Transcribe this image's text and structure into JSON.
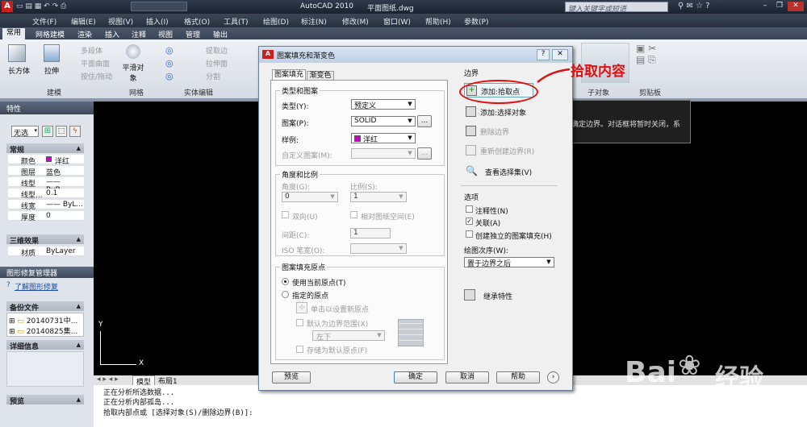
{
  "title_bar": {
    "app": "AutoCAD 2010",
    "file": "平面图纸.dwg",
    "search_placeholder": "键入关键字或短语"
  },
  "menu": [
    "文件(F)",
    "编辑(E)",
    "视图(V)",
    "插入(I)",
    "格式(O)",
    "工具(T)",
    "绘图(D)",
    "标注(N)",
    "修改(M)",
    "窗口(W)",
    "帮助(H)",
    "参数(P)"
  ],
  "ribbon_tabs": [
    "常用",
    "网格建模",
    "渲染",
    "插入",
    "注释",
    "视图",
    "管理",
    "输出"
  ],
  "ribbon": {
    "big_buttons": [
      "长方体",
      "拉伸",
      "平滑对象"
    ],
    "small_buttons": [
      "多段体",
      "平面曲面",
      "按住/拖动",
      "提取边",
      "拉伸面",
      "分割"
    ],
    "groups": [
      "建模",
      "网格",
      "实体编辑",
      "子对象",
      "剪贴板"
    ]
  },
  "properties_panel": {
    "title": "特性",
    "selection": "无选",
    "section_general": "常规",
    "rows": [
      {
        "k": "颜色",
        "v": "洋红"
      },
      {
        "k": "图层",
        "v": "蓝色"
      },
      {
        "k": "线型",
        "v": "—— ByB..."
      },
      {
        "k": "线型...",
        "v": "0.1"
      },
      {
        "k": "线宽",
        "v": "—— ByL..."
      },
      {
        "k": "厚度",
        "v": "0"
      }
    ],
    "section_3d": "三维效果",
    "row_material": {
      "k": "材质",
      "v": "ByLayer"
    }
  },
  "repair_panel": {
    "title": "图形修复管理器",
    "link": "了解图形修复",
    "backup_header": "备份文件",
    "files": [
      "20140731中...",
      "20140825集..."
    ],
    "details_header": "详细信息",
    "preview_header": "预览"
  },
  "model_tabs": [
    "模型",
    "布局1"
  ],
  "ucs": {
    "x": "X",
    "y": "Y"
  },
  "command_lines": [
    "正在分析所选数据...",
    "正在分析内部孤岛...",
    "拾取内部点或 [选择对象(S)/删除边界(B)]:"
  ],
  "dialog": {
    "title": "图案填充和渐变色",
    "tabs": [
      "图案填充",
      "渐变色"
    ],
    "type_pattern": {
      "legend": "类型和图案",
      "type_label": "类型(Y):",
      "type_value": "预定义",
      "pattern_label": "图案(P):",
      "pattern_value": "SOLID",
      "sample_label": "样例:",
      "sample_value": "洋红",
      "custom_label": "自定义图案(M):",
      "browse": "..."
    },
    "angle_scale": {
      "legend": "角度和比例",
      "angle_label": "角度(G):",
      "angle_value": "0",
      "scale_label": "比例(S):",
      "scale_value": "1",
      "double_label": "双向(U)",
      "relative_label": "相对图纸空间(E)",
      "spacing_label": "间距(C):",
      "spacing_value": "1",
      "iso_label": "ISO 笔宽(O):"
    },
    "origin": {
      "legend": "图案填充原点",
      "use_current": "使用当前原点(T)",
      "specified": "指定的原点",
      "click_set": "单击以设置新原点",
      "default_boundary": "默认为边界范围(X)",
      "position": "左下",
      "store_default": "存储为默认原点(F)"
    },
    "boundary": {
      "header": "边界",
      "add_pick": "添加:拾取点",
      "add_select": "添加:选择对象",
      "remove": "删除边界",
      "recreate": "重新创建边界(R)",
      "view_selection": "查看选择集(V)"
    },
    "tooltip": "根据构成封闭区域的选定对象确定边界。对话框将暂时关闭，系统将会提示拾取对象。",
    "options": {
      "header": "选项",
      "annotative": "注释性(N)",
      "associative": "关联(A)",
      "separate": "创建独立的图案填充(H)",
      "draw_order_label": "绘图次序(W):",
      "draw_order_value": "置于边界之后"
    },
    "inherit": "继承特性",
    "buttons": {
      "preview": "预览",
      "ok": "确定",
      "cancel": "取消",
      "help": "帮助"
    }
  },
  "annotation": {
    "text": "拾取内容",
    "color": "#e01010"
  },
  "watermark": {
    "brand": "Bai",
    "brand2": "经验",
    "url": "jingyan.baidu.com"
  },
  "colors": {
    "magenta": "#cc00cc",
    "ui_dark": "#27303e",
    "annotation": "#e01010"
  }
}
